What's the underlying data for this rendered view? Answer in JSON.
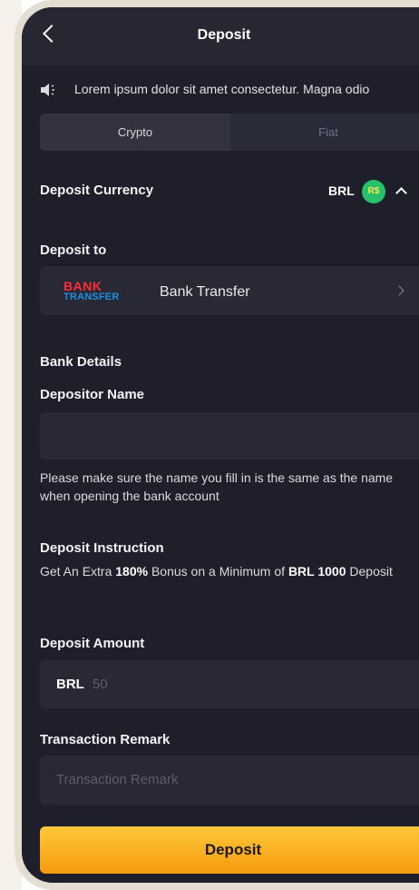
{
  "header": {
    "title": "Deposit"
  },
  "notice": {
    "text": "Lorem ipsum dolor sit amet consectetur. Magna odio"
  },
  "tabs": [
    {
      "label": "Crypto",
      "active": true
    },
    {
      "label": "Fiat",
      "active": false
    }
  ],
  "currency": {
    "label": "Deposit Currency",
    "code": "BRL",
    "badge": "R$"
  },
  "deposit_to": {
    "label": "Deposit to",
    "logo_line1": "BANK",
    "logo_line2": "TRANSFER",
    "method": "Bank Transfer"
  },
  "bank_details": {
    "label": "Bank Details",
    "depositor_label": "Depositor Name",
    "depositor_value": "",
    "hint": "Please make sure the name you fill in is the same as the name when opening the bank account"
  },
  "instruction": {
    "label": "Deposit Instruction",
    "prefix": "Get An Extra ",
    "bonus": "180%",
    "middle": " Bonus on a Minimum of ",
    "minimum": "BRL 1000",
    "suffix": " Deposit"
  },
  "amount": {
    "label": "Deposit Amount",
    "currency": "BRL",
    "placeholder": "50"
  },
  "remark": {
    "label": "Transaction Remark",
    "placeholder": "Transaction Remark"
  },
  "submit": {
    "label": "Deposit"
  },
  "colors": {
    "background": "#1e1f2b",
    "card": "#282935",
    "accent": "#ffb020",
    "badge": "#25c26b",
    "frame": "#e4ddd2"
  }
}
